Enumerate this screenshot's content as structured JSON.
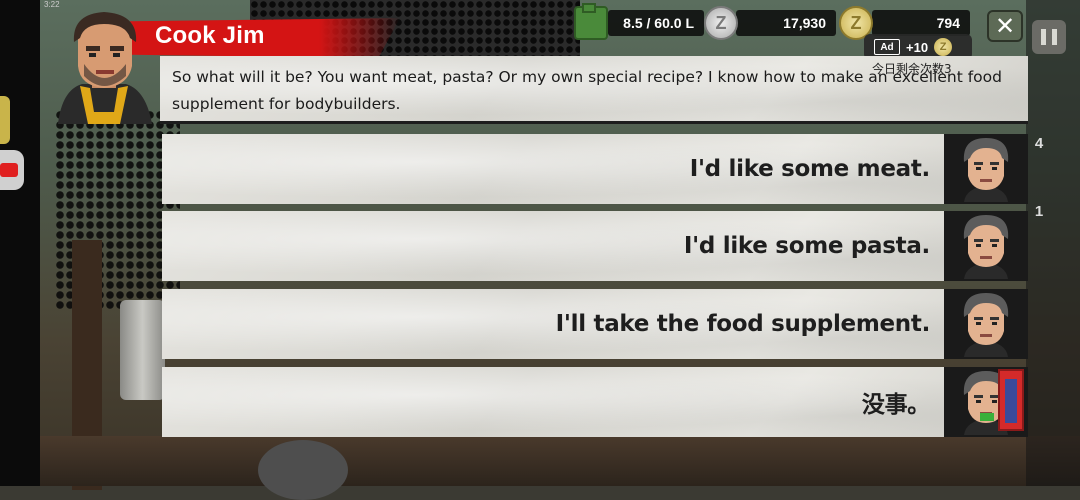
{
  "status_bar": {
    "time": "3:22"
  },
  "hud": {
    "fuel": "8.5 / 60.0 L",
    "silver_coins": "17,930",
    "gold_coins": "794",
    "ad_reward": "+10",
    "ad_label": "Ad",
    "ad_remaining_label": "今日剩余次数3",
    "coin_letter": "Z"
  },
  "speaker": {
    "name": "Cook Jim",
    "line": "So what will it be? You want meat, pasta? Or my own special recipe? I know how to make an excellent food supplement for bodybuilders."
  },
  "options": [
    {
      "label": "I'd like some meat."
    },
    {
      "label": "I'd like some pasta."
    },
    {
      "label": "I'll take the food supplement."
    },
    {
      "label": "没事。"
    }
  ],
  "side_counters": [
    "4",
    "1"
  ],
  "colors": {
    "banner_red": "#d41414",
    "paper": "#e2e1dc",
    "hud_bg": "#111111"
  }
}
